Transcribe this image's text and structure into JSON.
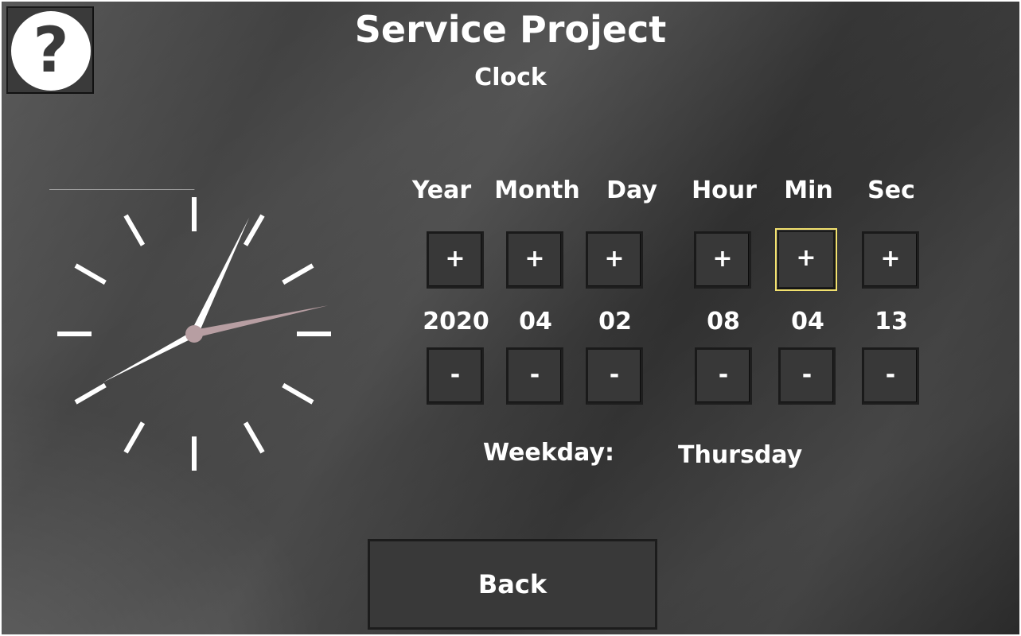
{
  "header": {
    "title": "Service Project",
    "subtitle": "Clock",
    "help_label": "?"
  },
  "clock": {
    "hour": 8,
    "minute": 4,
    "second": 13,
    "second_hand_color": "#b79ea2",
    "face_color": "#ffffff"
  },
  "fields": [
    {
      "label": "Year",
      "value": "2020",
      "plus": "+",
      "minus": "-"
    },
    {
      "label": "Month",
      "value": "04",
      "plus": "+",
      "minus": "-"
    },
    {
      "label": "Day",
      "value": "02",
      "plus": "+",
      "minus": "-"
    },
    {
      "label": "Hour",
      "value": "08",
      "plus": "+",
      "minus": "-"
    },
    {
      "label": "Min",
      "value": "04",
      "plus": "+",
      "minus": "-"
    },
    {
      "label": "Sec",
      "value": "13",
      "plus": "+",
      "minus": "-"
    }
  ],
  "weekday": {
    "label": "Weekday:",
    "value": "Thursday"
  },
  "back_label": "Back",
  "focus_color": "#f2e16f"
}
